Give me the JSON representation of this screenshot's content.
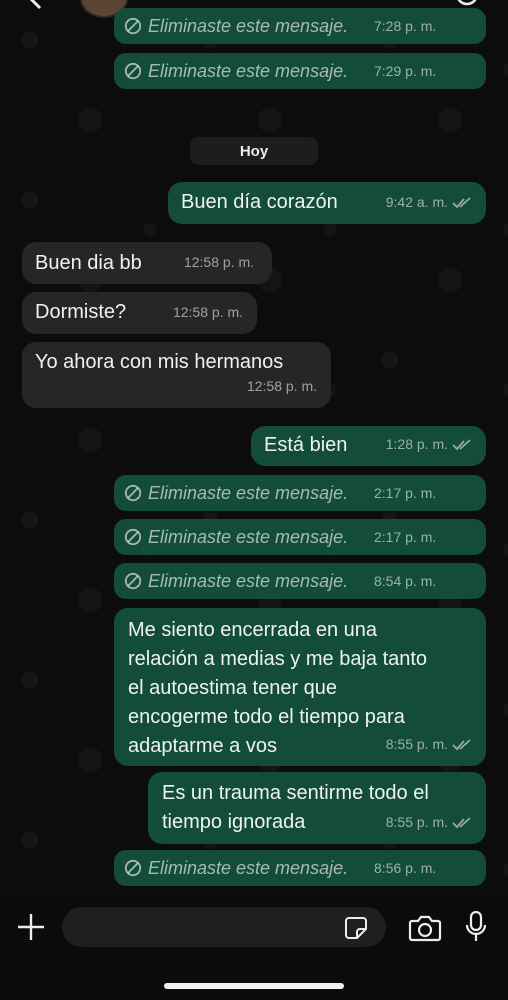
{
  "theme": {
    "outgoing_bubble": "#144d37",
    "incoming_bubble": "#262626",
    "read_ticks": "#9aa7a2"
  },
  "header": {
    "back_icon": "back-chevron-icon",
    "avatar": "contact-avatar",
    "call_icon": "call-icon"
  },
  "date_chip": "Hoy",
  "messages": [
    {
      "type": "deleted",
      "direction": "out",
      "text": "Eliminaste este mensaje.",
      "time": "7:28 p. m."
    },
    {
      "type": "deleted",
      "direction": "out",
      "text": "Eliminaste este mensaje.",
      "time": "7:29 p. m."
    },
    {
      "type": "text",
      "direction": "out",
      "text": "Buen día corazón",
      "time": "9:42 a. m.",
      "read": true
    },
    {
      "type": "text",
      "direction": "in",
      "text": "Buen dia bb",
      "time": "12:58 p. m."
    },
    {
      "type": "text",
      "direction": "in",
      "text": "Dormiste?",
      "time": "12:58 p. m."
    },
    {
      "type": "text",
      "direction": "in",
      "text": "Yo ahora con mis hermanos",
      "time": "12:58 p. m."
    },
    {
      "type": "text",
      "direction": "out",
      "text": "Está bien",
      "time": "1:28 p. m.",
      "read": true
    },
    {
      "type": "deleted",
      "direction": "out",
      "text": "Eliminaste este mensaje.",
      "time": "2:17 p. m."
    },
    {
      "type": "deleted",
      "direction": "out",
      "text": "Eliminaste este mensaje.",
      "time": "2:17 p. m."
    },
    {
      "type": "deleted",
      "direction": "out",
      "text": "Eliminaste este mensaje.",
      "time": "8:54 p. m."
    },
    {
      "type": "text",
      "direction": "out",
      "lines": [
        "Me siento encerrada en una",
        "relación a medias y me baja tanto",
        "el autoestima tener que",
        "encogerme todo el tiempo para",
        "adaptarme a vos"
      ],
      "time": "8:55 p. m.",
      "read": true
    },
    {
      "type": "text",
      "direction": "out",
      "lines": [
        "Es un trauma sentirme todo el",
        "tiempo ignorada"
      ],
      "time": "8:55 p. m.",
      "read": true
    },
    {
      "type": "deleted",
      "direction": "out",
      "text": "Eliminaste este mensaje.",
      "time": "8:56 p. m."
    }
  ],
  "composer": {
    "value": "",
    "icons": [
      "plus-icon",
      "sticker-icon",
      "camera-icon",
      "microphone-icon"
    ]
  }
}
